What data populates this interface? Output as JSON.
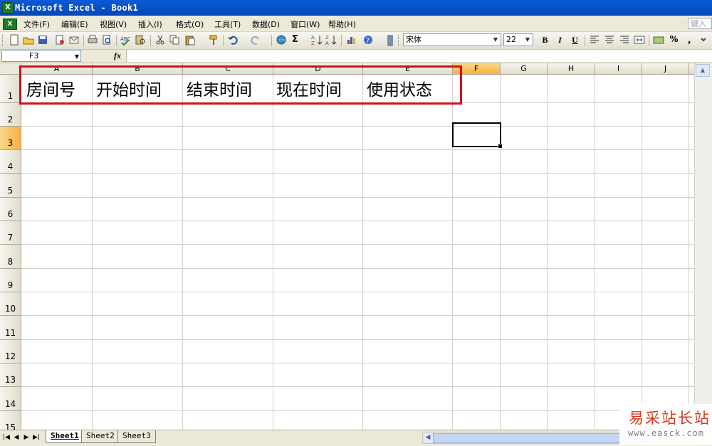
{
  "window": {
    "title": "Microsoft Excel - Book1"
  },
  "menubar": {
    "items": [
      {
        "label": "文件(F)"
      },
      {
        "label": "编辑(E)"
      },
      {
        "label": "视图(V)"
      },
      {
        "label": "插入(I)"
      },
      {
        "label": "格式(O)"
      },
      {
        "label": "工具(T)"
      },
      {
        "label": "数据(D)"
      },
      {
        "label": "窗口(W)"
      },
      {
        "label": "帮助(H)"
      }
    ],
    "help_box_text": "键入"
  },
  "toolbar": {
    "font_name": "宋体",
    "font_size": "22",
    "bold_label": "B",
    "italic_label": "I",
    "underline_label": "U",
    "percent_label": "%",
    "autosum_label": "Σ"
  },
  "formula_bar": {
    "name_box": "F3",
    "fx_label": "fx",
    "formula": ""
  },
  "sheet": {
    "columns": [
      "A",
      "B",
      "C",
      "D",
      "E",
      "F",
      "G",
      "H",
      "I",
      "J"
    ],
    "rows": [
      "1",
      "2",
      "3",
      "4",
      "5",
      "6",
      "7",
      "8",
      "9",
      "10",
      "11",
      "12",
      "13",
      "14",
      "15"
    ],
    "active_cell": "F3",
    "row1_values": [
      "房间号",
      "开始时间",
      "结束时间",
      "现在时间",
      "使用状态"
    ],
    "highlight_color": "#d0101a"
  },
  "tabs": {
    "sheets": [
      "Sheet1",
      "Sheet2",
      "Sheet3"
    ],
    "active": "Sheet1"
  },
  "watermark": {
    "name": "易采站长站",
    "url": "www.easck.com"
  }
}
